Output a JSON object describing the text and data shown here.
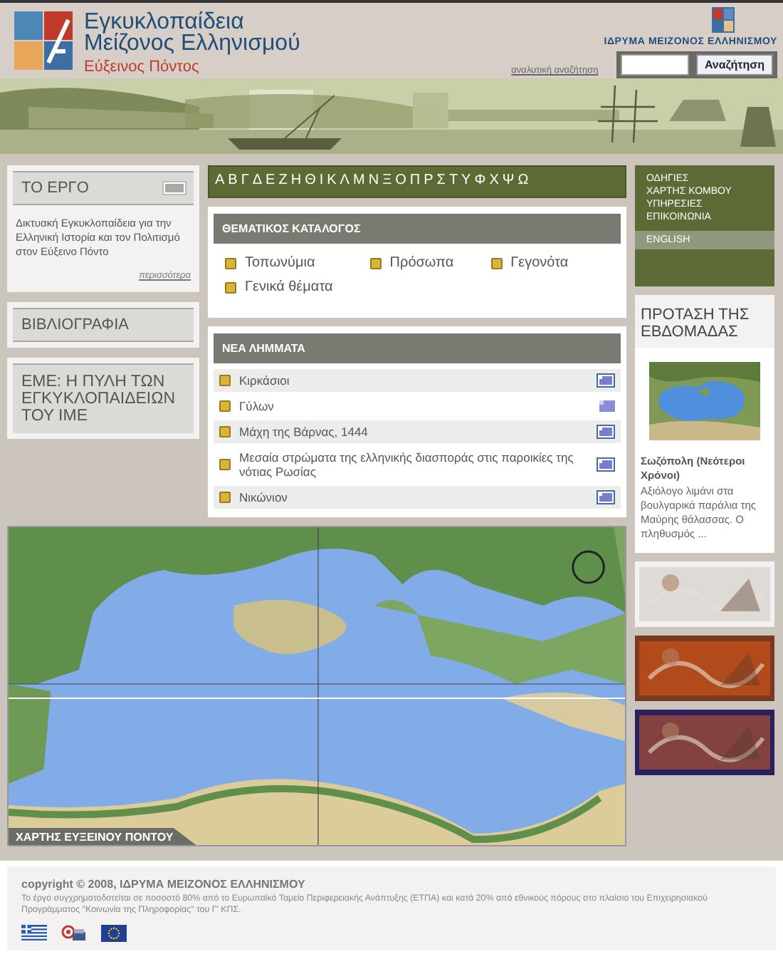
{
  "header": {
    "title_line_1": "Εγκυκλοπαίδεια",
    "title_line_2": "Μείζονος Ελληνισμού",
    "subtitle": "Εύξεινος Πόντος",
    "foundation": "ΙΔΡΥΜΑ ΜΕΙΖΟΝΟΣ ΕΛΛΗΝΙΣΜΟΥ",
    "advanced_search": "αναλυτική αναζήτηση",
    "search_button": "Αναζήτηση"
  },
  "sidebar": {
    "about": {
      "title": "ΤΟ ΕΡΓΟ",
      "expanded": true,
      "text": "Δικτυακή Εγκυκλοπαίδεια για την Ελληνική Ιστορία και τον Πολιτισμό στον Εύξεινο Πόντο",
      "more": "περισσότερα"
    },
    "bibliography": "ΒΙΒΛΙΟΓΡΑΦΙΑ",
    "portal": "ΕΜΕ: Η ΠΥΛΗ ΤΩΝ ΕΓΚΥΚΛΟΠΑΙΔΕΙΩΝ ΤΟΥ ΙΜΕ"
  },
  "alphabet": [
    "Α",
    "Β",
    "Γ",
    "Δ",
    "Ε",
    "Ζ",
    "Η",
    "Θ",
    "Ι",
    "Κ",
    "Λ",
    "Μ",
    "Ν",
    "Ξ",
    "Ο",
    "Π",
    "Ρ",
    "Σ",
    "Τ",
    "Υ",
    "Φ",
    "Χ",
    "Ψ",
    "Ω"
  ],
  "catalog": {
    "title": "ΘΕΜΑΤΙΚΟΣ ΚΑΤΑΛΟΓΟΣ",
    "items": [
      "Τοπωνύμια",
      "Πρόσωπα",
      "Γεγονότα",
      "Γενικά θέματα"
    ]
  },
  "news": {
    "title": "ΝΕΑ ΛΗΜΜΑΤΑ",
    "items": [
      {
        "label": "Κιρκάσιοι",
        "kind": "framed"
      },
      {
        "label": "Γύλων",
        "kind": "plain"
      },
      {
        "label": "Μάχη της Βάρνας, 1444",
        "kind": "framed"
      },
      {
        "label": "Μεσαία στρώματα της ελληνικής διασποράς στις παροικίες της νότιας Ρωσίας",
        "kind": "framed"
      },
      {
        "label": "Νικώνιον",
        "kind": "framed"
      }
    ]
  },
  "map": {
    "caption": "ΧΑΡΤΗΣ ΕΥΞΕΙΝΟΥ ΠΟΝΤΟΥ"
  },
  "nav": {
    "items": [
      "ΟΔΗΓΙΕΣ",
      "ΧΑΡΤΗΣ ΚΟΜΒΟΥ",
      "ΥΠΗΡΕΣΙΕΣ",
      "ΕΠΙΚΟΙΝΩΝΙΑ"
    ],
    "language": "ENGLISH"
  },
  "proposal": {
    "title": "ΠΡΟΤΑΣΗ ΤΗΣ ΕΒΔΟΜΑΔΑΣ",
    "entry": "Σωζόπολη (Νεότεροι Χρόνοι)",
    "text": "Αξιόλογο λιμάνι στα βουλγαρικά παράλια της Μαύρης θάλασσας. Ο πληθυσμός ..."
  },
  "footer": {
    "copyright": "copyright © 2008, ΙΔΡΥΜΑ ΜΕΙΖΟΝΟΣ ΕΛΛΗΝΙΣΜΟΥ",
    "funding": "Το έργο συγχρηματοδοτείται σε ποσοστό 80% από το Ευρωπαϊκό Ταμείο Περιφερειακής Ανάπτυξης (ΕΤΠΑ) και κατά 20% από εθνικούς πόρους στο πλαίσιο του Επιχειρησιακού Προγράμματος \"Κοινωνία της Πληροφορίας\" του Γ' ΚΠΣ."
  }
}
